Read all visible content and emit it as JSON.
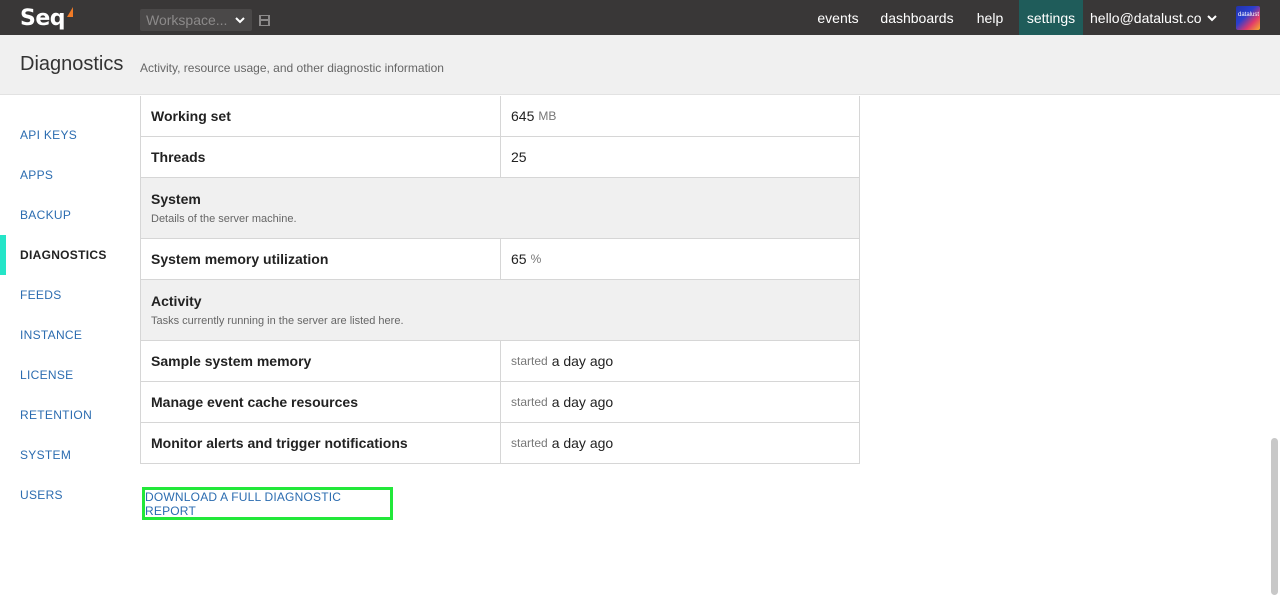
{
  "app": {
    "logo_text": "Seq"
  },
  "topbar": {
    "workspace_label": "Workspace...",
    "nav": [
      {
        "label": "events"
      },
      {
        "label": "dashboards"
      },
      {
        "label": "help"
      },
      {
        "label": "settings"
      }
    ],
    "user_email": "hello@datalust.co",
    "avatar_text": "datalust"
  },
  "header": {
    "title": "Diagnostics",
    "subtitle": "Activity, resource usage, and other diagnostic information"
  },
  "sidebar": {
    "items": [
      {
        "label": "API KEYS"
      },
      {
        "label": "APPS"
      },
      {
        "label": "BACKUP"
      },
      {
        "label": "DIAGNOSTICS"
      },
      {
        "label": "FEEDS"
      },
      {
        "label": "INSTANCE"
      },
      {
        "label": "LICENSE"
      },
      {
        "label": "RETENTION"
      },
      {
        "label": "SYSTEM"
      },
      {
        "label": "USERS"
      }
    ]
  },
  "table": {
    "process_rows": [
      {
        "key": "Working set",
        "value": "645",
        "unit": "MB"
      },
      {
        "key": "Threads",
        "value": "25"
      }
    ],
    "system_section": {
      "title": "System",
      "description": "Details of the server machine."
    },
    "system_rows": [
      {
        "key": "System memory utilization",
        "value": "65",
        "unit": "%"
      }
    ],
    "activity_section": {
      "title": "Activity",
      "description": "Tasks currently running in the server are listed here."
    },
    "activity_rows": [
      {
        "key": "Sample system memory",
        "prefix": "started",
        "value": "a day ago"
      },
      {
        "key": "Manage event cache resources",
        "prefix": "started",
        "value": "a day ago"
      },
      {
        "key": "Monitor alerts and trigger notifications",
        "prefix": "started",
        "value": "a day ago"
      }
    ]
  },
  "download_label": "DOWNLOAD A FULL DIAGNOSTIC REPORT",
  "colors": {
    "topbar": "#393737",
    "active_nav": "#1f5c5a",
    "sidebar_active_marker": "#25e5c8",
    "link": "#2b6cb0",
    "highlight_border": "#22e83a"
  }
}
